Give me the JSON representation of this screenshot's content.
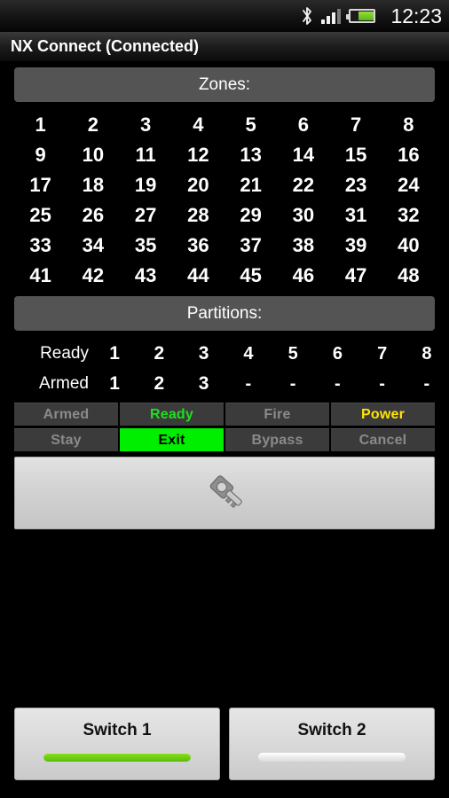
{
  "statusbar": {
    "bluetooth_icon": "bluetooth-icon",
    "signal_icon": "signal-bars-icon",
    "battery_icon": "battery-icon",
    "time": "12:23"
  },
  "titlebar": {
    "title": "NX Connect (Connected)"
  },
  "zones": {
    "header": "Zones:",
    "numbers": [
      "1",
      "2",
      "3",
      "4",
      "5",
      "6",
      "7",
      "8",
      "9",
      "10",
      "11",
      "12",
      "13",
      "14",
      "15",
      "16",
      "17",
      "18",
      "19",
      "20",
      "21",
      "22",
      "23",
      "24",
      "25",
      "26",
      "27",
      "28",
      "29",
      "30",
      "31",
      "32",
      "33",
      "34",
      "35",
      "36",
      "37",
      "38",
      "39",
      "40",
      "41",
      "42",
      "43",
      "44",
      "45",
      "46",
      "47",
      "48"
    ]
  },
  "partitions": {
    "header": "Partitions:",
    "ready": {
      "label": "Ready",
      "values": [
        "1",
        "2",
        "3",
        "4",
        "5",
        "6",
        "7",
        "8"
      ]
    },
    "armed": {
      "label": "Armed",
      "values": [
        "1",
        "2",
        "3",
        "-",
        "-",
        "-",
        "-",
        "-"
      ]
    }
  },
  "status_buttons": {
    "row1": [
      {
        "label": "Armed",
        "state": "inactive"
      },
      {
        "label": "Ready",
        "state": "active-text"
      },
      {
        "label": "Fire",
        "state": "inactive"
      },
      {
        "label": "Power",
        "state": "warn-text"
      }
    ],
    "row2": [
      {
        "label": "Stay",
        "state": "inactive"
      },
      {
        "label": "Exit",
        "state": "active-fill"
      },
      {
        "label": "Bypass",
        "state": "inactive"
      },
      {
        "label": "Cancel",
        "state": "inactive"
      }
    ]
  },
  "key_button": {
    "icon": "key-icon"
  },
  "switches": [
    {
      "label": "Switch 1",
      "state": "on"
    },
    {
      "label": "Switch 2",
      "state": "off"
    }
  ],
  "colors": {
    "accent_green": "#00ee00",
    "text_green": "#22dd22",
    "warn_yellow": "#ffe400",
    "button_bg": "#3b3b3b",
    "button_text": "#8a8a8a",
    "section_header_bg": "#545454",
    "background": "#000000",
    "switch_on": "#6fcc15"
  }
}
